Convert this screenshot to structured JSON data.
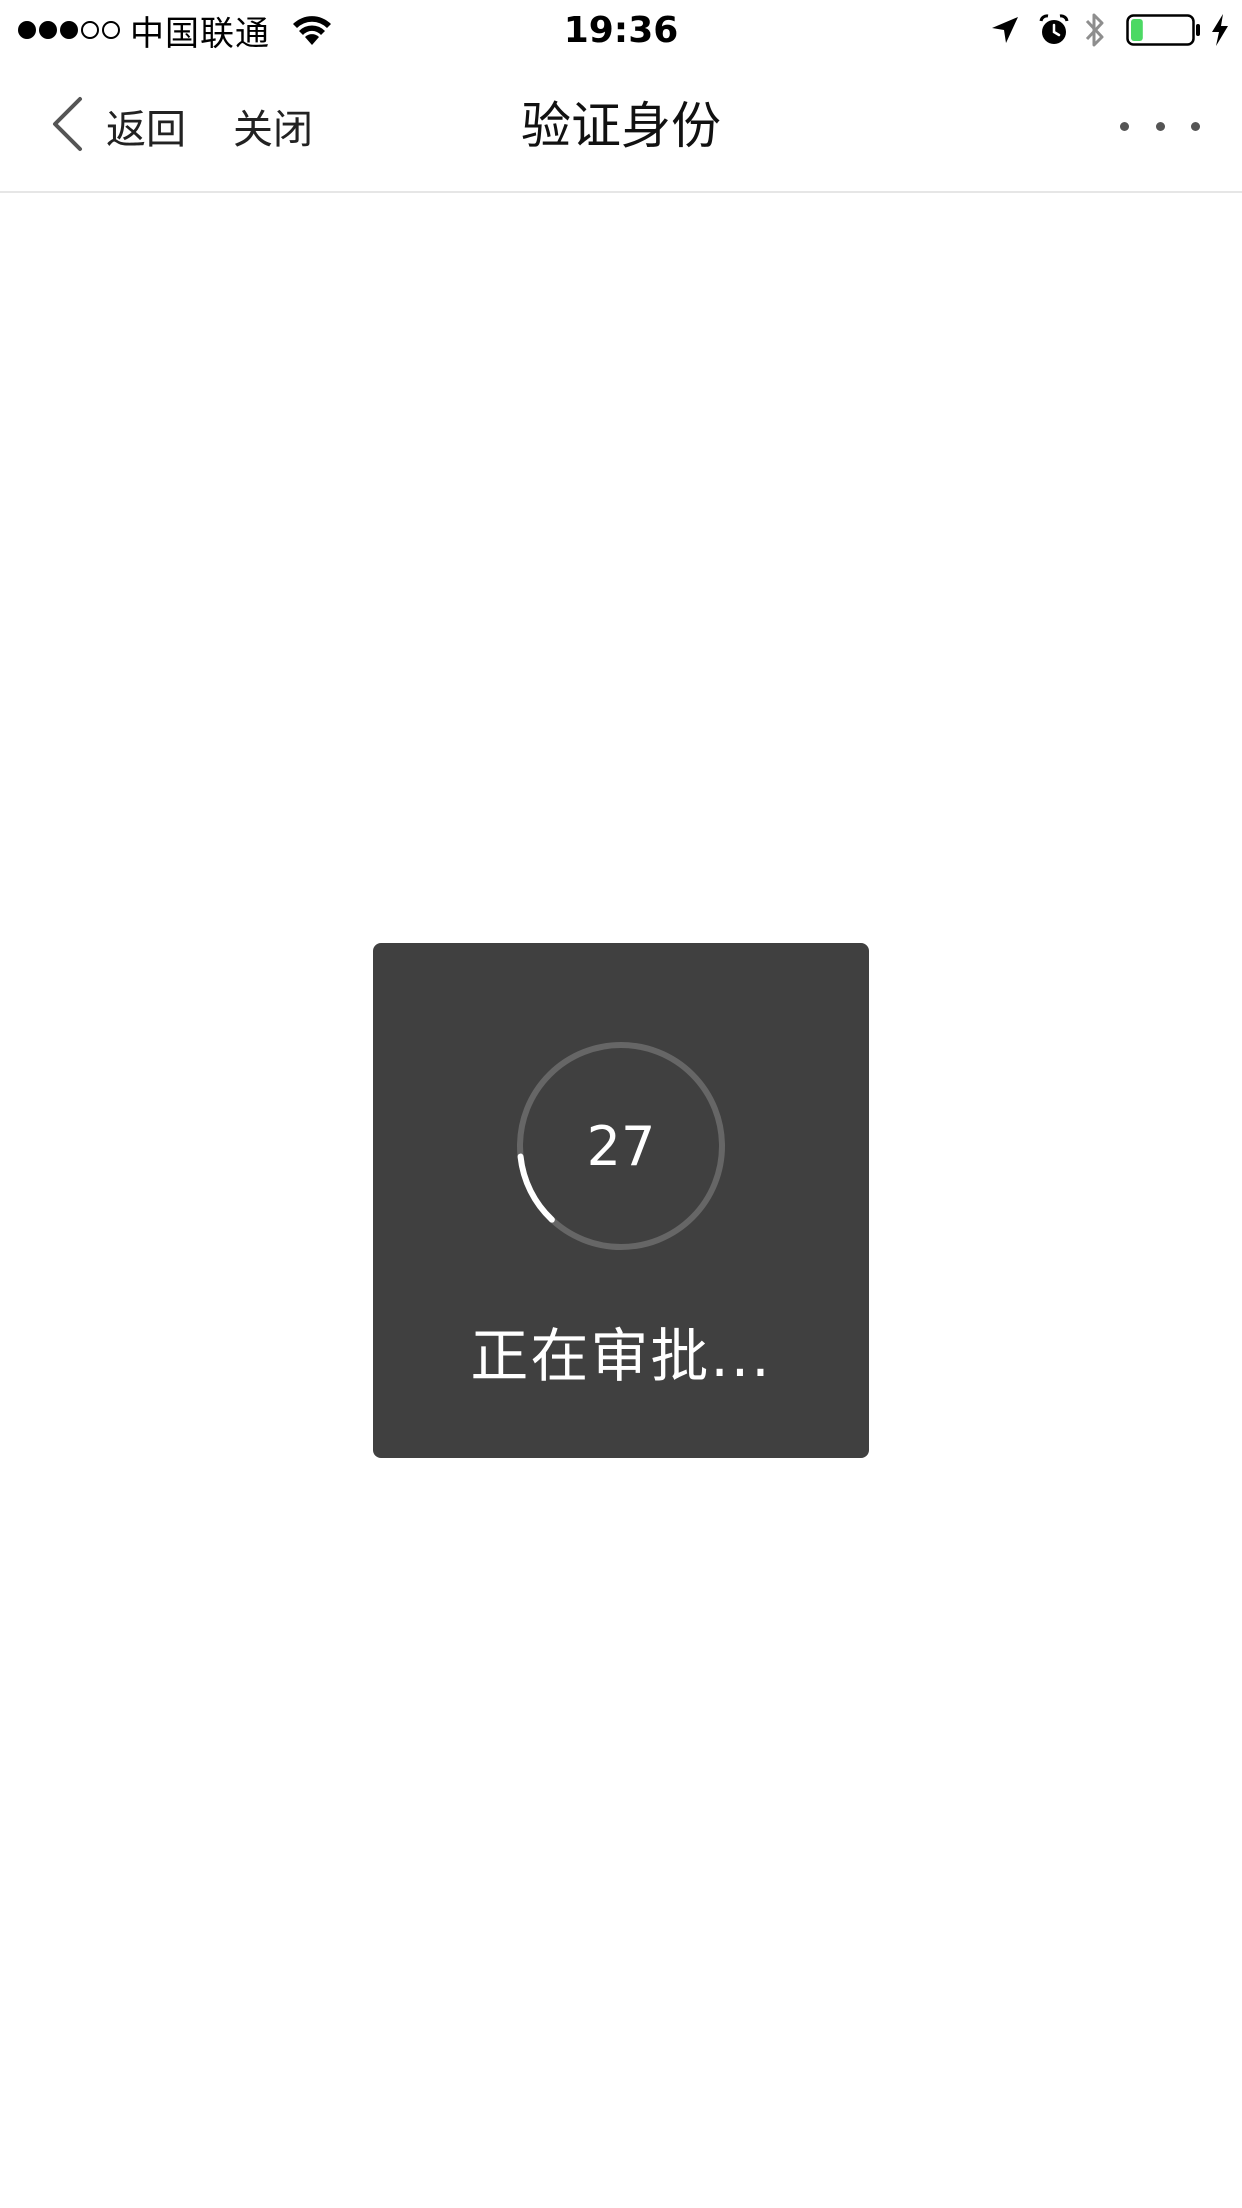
{
  "status_bar": {
    "signal_bars_filled": 3,
    "signal_bars_total": 5,
    "carrier": "中国联通",
    "time": "19:36",
    "battery_level": 0.2,
    "icons": [
      "wifi-icon",
      "location-arrow-icon",
      "alarm-icon",
      "bluetooth-icon",
      "battery-icon",
      "charging-bolt-icon"
    ]
  },
  "nav": {
    "back_label": "返回",
    "close_label": "关闭",
    "title": "验证身份",
    "more_icon": "ellipsis-icon"
  },
  "toast": {
    "countdown": "27",
    "message": "正在审批...",
    "progress": 0.27
  },
  "colors": {
    "toast_bg": "#404040",
    "ring_track": "#666666",
    "ring_progress": "#ffffff",
    "battery_fill": "#4cd964"
  }
}
